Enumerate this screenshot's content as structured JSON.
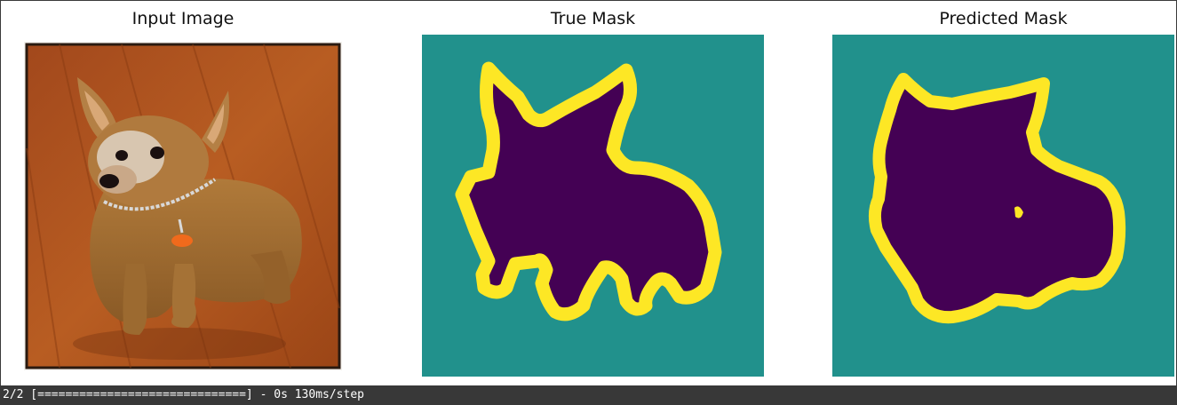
{
  "figure": {
    "panels": [
      {
        "title": "Input Image",
        "content": "photo of a small tan chihuahua-mix dog wearing a chain collar with an orange tag, sitting on a wooden floor"
      },
      {
        "title": "True Mask"
      },
      {
        "title": "Predicted Mask"
      }
    ],
    "mask_colors": {
      "background": "#21918c",
      "foreground": "#440154",
      "border": "#fde725"
    }
  },
  "output": {
    "progress_text": "2/2 [==============================] - 0s 130ms/step"
  }
}
